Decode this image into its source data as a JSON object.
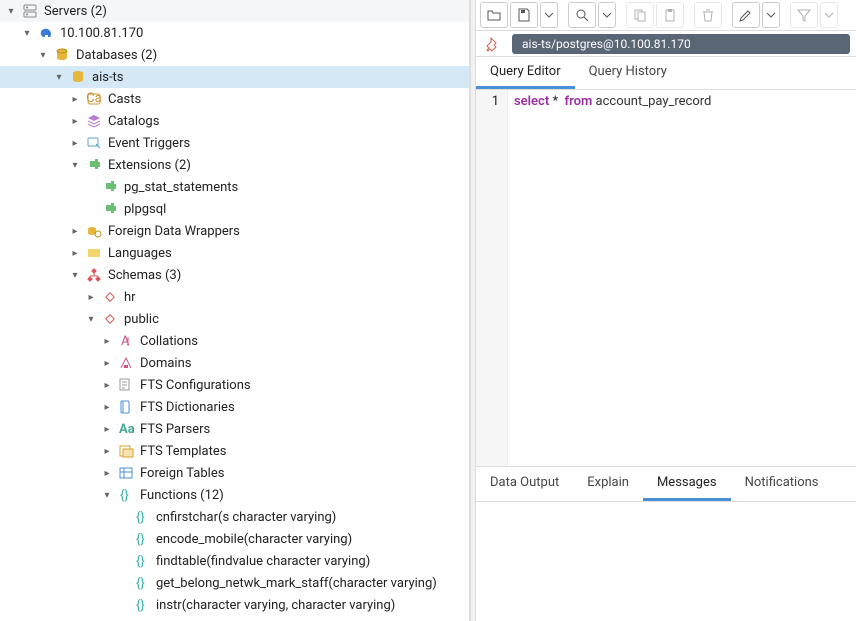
{
  "tree": {
    "servers": {
      "label": "Servers (2)"
    },
    "server1": {
      "label": "10.100.81.170"
    },
    "databases": {
      "label": "Databases (2)"
    },
    "db_aists": {
      "label": "ais-ts"
    },
    "casts": {
      "label": "Casts"
    },
    "catalogs": {
      "label": "Catalogs"
    },
    "event_triggers": {
      "label": "Event Triggers"
    },
    "extensions": {
      "label": "Extensions (2)"
    },
    "ext1": {
      "label": "pg_stat_statements"
    },
    "ext2": {
      "label": "plpgsql"
    },
    "fdw": {
      "label": "Foreign Data Wrappers"
    },
    "languages": {
      "label": "Languages"
    },
    "schemas": {
      "label": "Schemas (3)"
    },
    "schema_hr": {
      "label": "hr"
    },
    "schema_public": {
      "label": "public"
    },
    "collations": {
      "label": "Collations"
    },
    "domains": {
      "label": "Domains"
    },
    "fts_cfg": {
      "label": "FTS Configurations"
    },
    "fts_dict": {
      "label": "FTS Dictionaries"
    },
    "fts_parsers": {
      "label": "FTS Parsers"
    },
    "fts_templates": {
      "label": "FTS Templates"
    },
    "foreign_tables": {
      "label": "Foreign Tables"
    },
    "functions": {
      "label": "Functions (12)"
    },
    "fn1": {
      "label": "cnfirstchar(s character varying)"
    },
    "fn2": {
      "label": "encode_mobile(character varying)"
    },
    "fn3": {
      "label": "findtable(findvalue character varying)"
    },
    "fn4": {
      "label": "get_belong_netwk_mark_staff(character varying)"
    },
    "fn5": {
      "label": "instr(character varying, character varying)"
    }
  },
  "right": {
    "conn": "ais-ts/postgres@10.100.81.170",
    "tabs": {
      "editor": "Query Editor",
      "history": "Query History"
    },
    "gutter1": "1",
    "sql1": "select",
    "sql2": "*",
    "sql3": "from",
    "sql4": "account_pay_record",
    "ltabs": {
      "data": "Data Output",
      "explain": "Explain",
      "messages": "Messages",
      "notif": "Notifications"
    }
  }
}
